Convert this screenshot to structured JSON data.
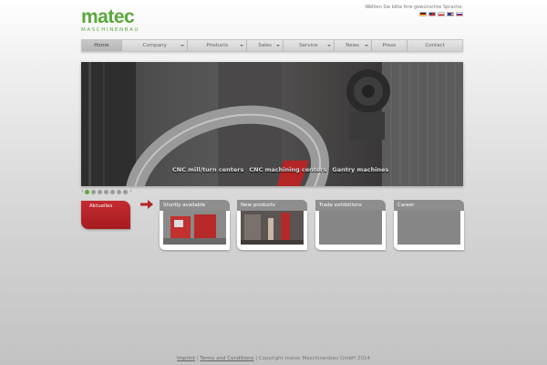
{
  "logo": {
    "main": "matec",
    "sub": "MASCHINENBAU"
  },
  "language": {
    "prompt": "Wählen Sie bitte Ihre gewünschte Sprache:",
    "flags": [
      "german-flag-icon",
      "english-flag-icon",
      "polish-flag-icon",
      "us-flag-icon",
      "russian-flag-icon"
    ]
  },
  "nav": {
    "items": [
      {
        "label": "Home",
        "active": true,
        "dropdown": false
      },
      {
        "label": "Company",
        "dropdown": true
      },
      {
        "label": "Products",
        "dropdown": true
      },
      {
        "label": "Sales",
        "dropdown": true
      },
      {
        "label": "Service",
        "dropdown": true
      },
      {
        "label": "News",
        "dropdown": true
      },
      {
        "label": "Press",
        "dropdown": false
      },
      {
        "label": "Contact",
        "dropdown": false
      }
    ]
  },
  "hero": {
    "links": [
      "CNC mill/turn centers",
      "CNC machining centers",
      "Gantry machines"
    ]
  },
  "pager": {
    "prev": "‹",
    "next": "›",
    "count": 7,
    "active_index": 0
  },
  "aktuelles": {
    "label": "Aktuelles"
  },
  "cards": [
    {
      "title": "Shortly available",
      "has_image": true
    },
    {
      "title": "New products",
      "has_image": true
    },
    {
      "title": "Trade exhibitions",
      "has_image": false
    },
    {
      "title": "Career",
      "has_image": false
    }
  ],
  "footer": {
    "imprint": "Imprint",
    "sep1": "|",
    "terms": "Terms and Conditions",
    "sep2": "|",
    "copyright": "Copyright matec Maschinenbau GmbH 2014"
  },
  "colors": {
    "brand_green": "#5aa83c",
    "accent_red": "#b52428",
    "card_header": "#8e8e8e"
  }
}
